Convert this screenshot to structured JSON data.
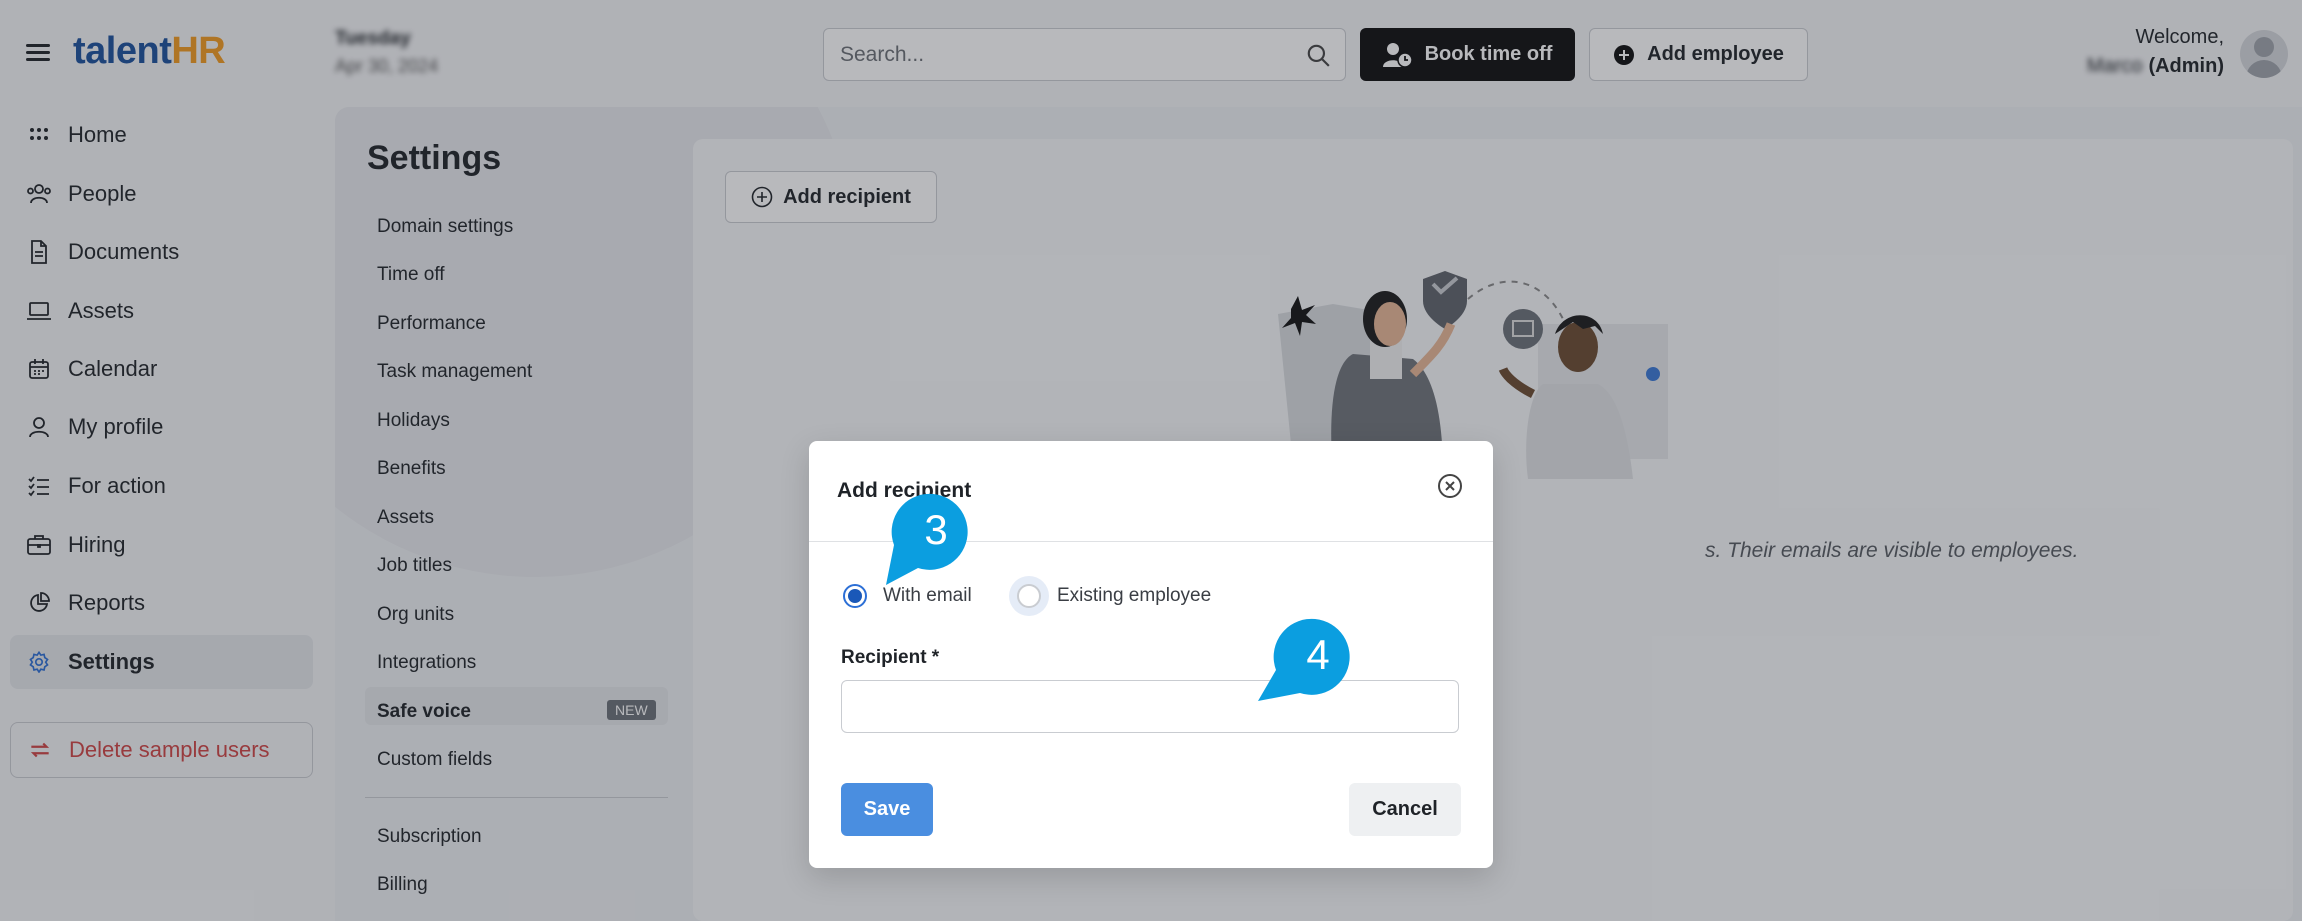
{
  "app": {
    "logo_part1": "talent",
    "logo_part2": "HR",
    "date_day": "Tuesday",
    "date_full": "Apr 30, 2024",
    "colors": {
      "brand_blue": "#1a4f9c",
      "brand_orange": "#f29a1f",
      "accent": "#2c6fd6",
      "danger": "#d04444"
    }
  },
  "topbar": {
    "search_placeholder": "Search...",
    "book_time_off": "Book time off",
    "add_employee": "Add employee",
    "welcome": "Welcome,",
    "user_name": "Marco",
    "user_role": "(Admin)"
  },
  "sidebar": {
    "items": [
      {
        "label": "Home",
        "icon": "grid-icon"
      },
      {
        "label": "People",
        "icon": "people-icon"
      },
      {
        "label": "Documents",
        "icon": "document-icon"
      },
      {
        "label": "Assets",
        "icon": "laptop-icon"
      },
      {
        "label": "Calendar",
        "icon": "calendar-icon"
      },
      {
        "label": "My profile",
        "icon": "user-icon"
      },
      {
        "label": "For action",
        "icon": "checklist-icon"
      },
      {
        "label": "Hiring",
        "icon": "briefcase-icon"
      },
      {
        "label": "Reports",
        "icon": "pie-chart-icon"
      },
      {
        "label": "Settings",
        "icon": "gear-icon",
        "active": true
      }
    ],
    "delete_sample": "Delete sample users"
  },
  "settings": {
    "title": "Settings",
    "items": [
      "Domain settings",
      "Time off",
      "Performance",
      "Task management",
      "Holidays",
      "Benefits",
      "Assets",
      "Job titles",
      "Org units",
      "Integrations",
      "Safe voice",
      "Custom fields",
      "Subscription",
      "Billing"
    ],
    "new_badge": "NEW"
  },
  "content": {
    "add_recipient": "Add recipient",
    "empty_text": "s. Their emails are visible to employees."
  },
  "modal": {
    "title": "Add recipient",
    "radio_email": "With email",
    "radio_existing": "Existing employee",
    "recipient_label": "Recipient *",
    "recipient_value": "",
    "save": "Save",
    "cancel": "Cancel"
  },
  "callouts": {
    "step3": "3",
    "step4": "4"
  }
}
